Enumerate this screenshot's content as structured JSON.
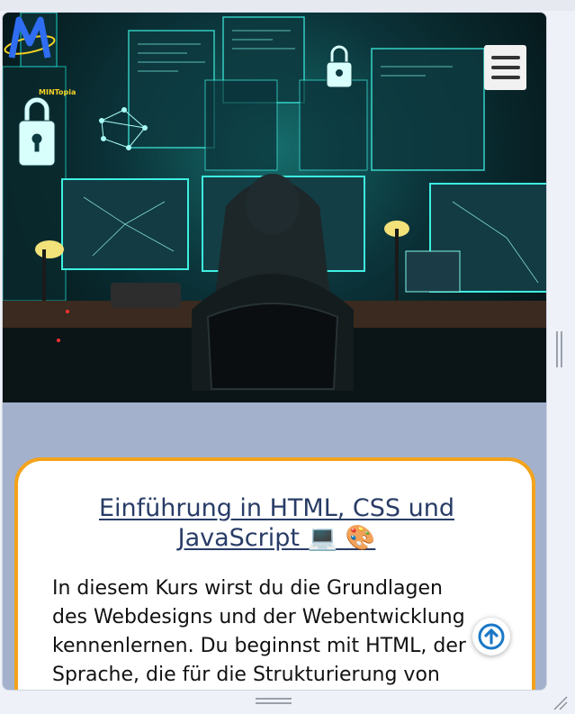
{
  "logo": {
    "text": "MINTopia"
  },
  "menu": {
    "icon": "hamburger-icon"
  },
  "course_card": {
    "title_line1": "Einführung in HTML, CSS und",
    "title_line2": "JavaScript 💻 🎨",
    "text_lines": [
      "In diesem Kurs wirst du die Grundlagen",
      "des Webdesigns und der Webentwicklung",
      "kennenlernen. Du beginnst mit HTML, der",
      "Sprache, die für die Strukturierung von"
    ]
  },
  "scroll_top": {
    "icon": "arrow-up-circle-icon"
  },
  "colors": {
    "page_bg": "#a4b1cc",
    "card_border": "#f3a31b",
    "title": "#283c66",
    "scroll_button_icon": "#1b78c6"
  }
}
